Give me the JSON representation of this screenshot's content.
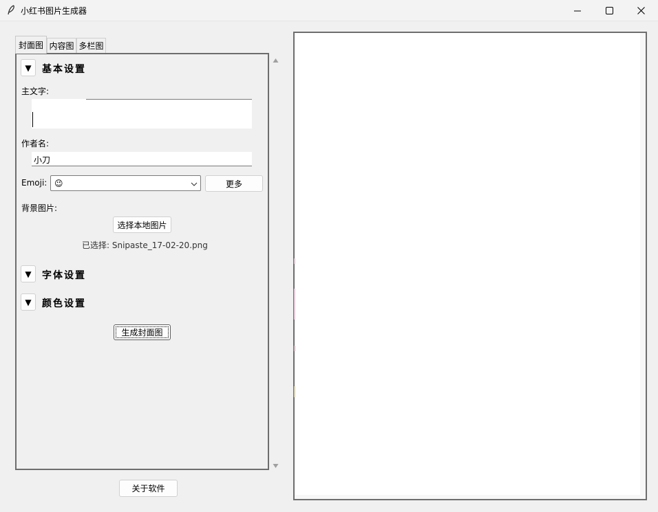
{
  "window": {
    "title": "小红书图片生成器"
  },
  "tabs": [
    {
      "label": "封面图",
      "active": true
    },
    {
      "label": "内容图",
      "active": false
    },
    {
      "label": "多栏图",
      "active": false
    }
  ],
  "sections": {
    "basic": {
      "toggle": "▼",
      "title": "基本设置"
    },
    "font": {
      "toggle": "▼",
      "title": "字体设置"
    },
    "color": {
      "toggle": "▼",
      "title": "颜色设置"
    }
  },
  "form": {
    "main_text_label": "主文字:",
    "main_text_value": "",
    "author_label": "作者名:",
    "author_value": "小刀",
    "emoji_label": "Emoji:",
    "emoji_value": "😉",
    "more_button": "更多",
    "background_label": "背景图片:",
    "choose_image_button": "选择本地图片",
    "selected_file_text": "已选择: Snipaste_17-02-20.png",
    "generate_button": "生成封面图"
  },
  "footer": {
    "about_button": "关于软件"
  },
  "icons": {
    "app": "feather-icon",
    "minimize": "minimize-icon",
    "maximize": "maximize-icon",
    "close": "close-icon",
    "scroll_up": "scroll-up-arrow-icon",
    "scroll_down": "scroll-down-arrow-icon",
    "dropdown": "chevron-down-icon"
  }
}
